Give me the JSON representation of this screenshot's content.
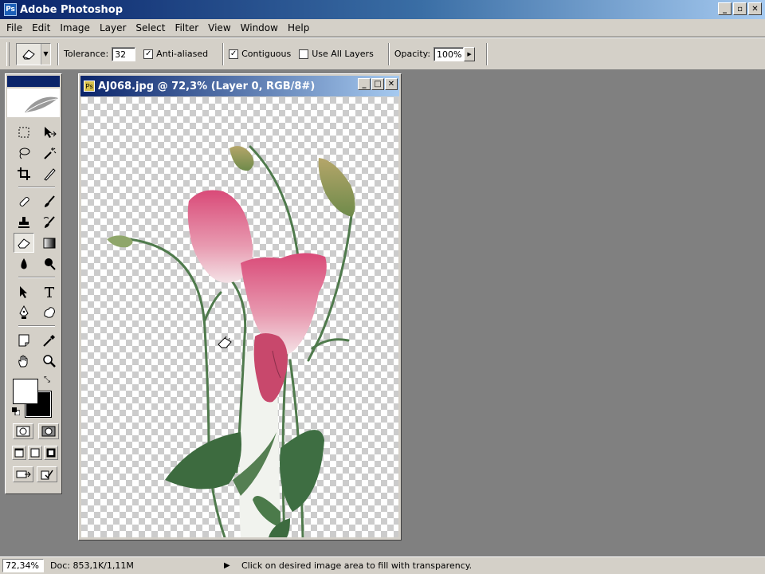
{
  "app": {
    "title": "Adobe Photoshop",
    "icon": "photoshop-icon"
  },
  "window_buttons": {
    "minimize": "_",
    "maximize": "▫",
    "close": "✕"
  },
  "menu": [
    "File",
    "Edit",
    "Image",
    "Layer",
    "Select",
    "Filter",
    "View",
    "Window",
    "Help"
  ],
  "options": {
    "tool_icon": "magic-eraser-icon",
    "tolerance_label": "Tolerance:",
    "tolerance_value": "32",
    "anti_aliased_label": "Anti-aliased",
    "anti_aliased_checked": true,
    "contiguous_label": "Contiguous",
    "contiguous_checked": true,
    "use_all_layers_label": "Use All Layers",
    "use_all_layers_checked": false,
    "opacity_label": "Opacity:",
    "opacity_value": "100%"
  },
  "document": {
    "title": "AJ068.jpg @ 72,3% (Layer 0, RGB/8#)",
    "icon": "document-icon"
  },
  "toolbox": {
    "tools": [
      "marquee-icon",
      "move-icon",
      "lasso-icon",
      "magic-wand-icon",
      "crop-icon",
      "slice-icon",
      "healing-brush-icon",
      "brush-icon",
      "clone-stamp-icon",
      "history-brush-icon",
      "eraser-icon",
      "gradient-icon",
      "blur-icon",
      "burn-icon",
      "path-selection-icon",
      "type-icon",
      "pen-icon",
      "custom-shape-icon",
      "notes-icon",
      "eyedropper-icon",
      "hand-icon",
      "zoom-icon"
    ],
    "foreground_color": "#ffffff",
    "background_color": "#000000"
  },
  "status": {
    "zoom": "72,34%",
    "doc_size": "Doc: 853,1K/1,11M",
    "hint": "Click on desired image area to fill with transparency."
  },
  "colors": {
    "titlebar_dark": "#0a246a",
    "titlebar_light": "#a6caf0",
    "chrome": "#d4d0c8",
    "workspace": "#808080",
    "petal_pink": "#c9446b",
    "leaf_green": "#3d6b3f"
  }
}
